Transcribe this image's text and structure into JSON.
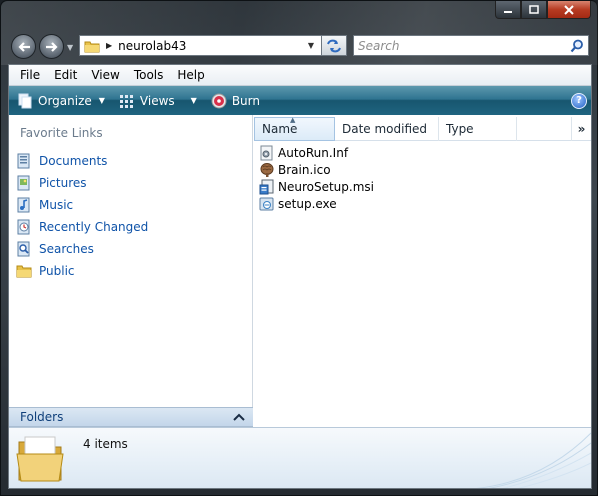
{
  "window": {
    "caption": {
      "minimize_icon": "minimize-icon",
      "maximize_icon": "maximize-icon",
      "close_icon": "close-icon"
    }
  },
  "navigation": {
    "back_icon": "back-arrow-icon",
    "forward_icon": "forward-arrow-icon",
    "address": {
      "path": "neurolab43"
    },
    "search": {
      "placeholder": "Search"
    }
  },
  "menubar": {
    "items": [
      "File",
      "Edit",
      "View",
      "Tools",
      "Help"
    ]
  },
  "toolbar": {
    "organize_label": "Organize",
    "views_label": "Views",
    "burn_label": "Burn",
    "help_icon": "help-icon"
  },
  "navpane": {
    "title": "Favorite Links",
    "items": [
      {
        "label": "Documents",
        "icon": "documents-icon"
      },
      {
        "label": "Pictures",
        "icon": "pictures-icon"
      },
      {
        "label": "Music",
        "icon": "music-icon"
      },
      {
        "label": "Recently Changed",
        "icon": "recently-changed-icon"
      },
      {
        "label": "Searches",
        "icon": "searches-icon"
      },
      {
        "label": "Public",
        "icon": "public-folder-icon"
      }
    ],
    "folders_label": "Folders"
  },
  "filelist": {
    "columns": {
      "name": "Name",
      "date": "Date modified",
      "type": "Type",
      "more": "»"
    },
    "files": [
      {
        "name": "AutoRun.Inf",
        "icon": "settings-file-icon"
      },
      {
        "name": "Brain.ico",
        "icon": "brain-icon"
      },
      {
        "name": "NeuroSetup.msi",
        "icon": "installer-icon"
      },
      {
        "name": "setup.exe",
        "icon": "setup-exe-icon"
      }
    ]
  },
  "details": {
    "item_count": "4 items"
  },
  "colors": {
    "toolbar": "#2f7491",
    "link": "#0f53a8",
    "frame": "#2b3238"
  }
}
